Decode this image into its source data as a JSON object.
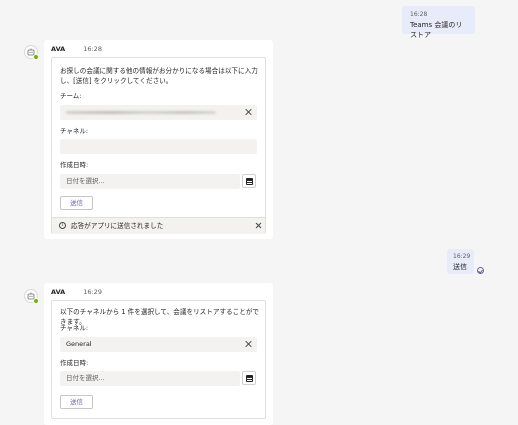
{
  "outgoing": [
    {
      "time": "16:28",
      "text": "Teams 会議のリストア"
    },
    {
      "time": "16:29",
      "text": "送信"
    }
  ],
  "bot_messages": [
    {
      "sender": "AVA",
      "time": "16:28",
      "card": {
        "instruction": "お探しの会議に関する他の情報がお分かりになる場合は以下に入力し、[送信] をクリックしてください。",
        "team_label": "チーム:",
        "channel_label": "チャネル:",
        "date_label": "作成日時:",
        "date_placeholder": "日付を選択...",
        "submit_label": "送信"
      },
      "notice": "応答がアプリに送信されました"
    },
    {
      "sender": "AVA",
      "time": "16:29",
      "card": {
        "instruction": "以下のチャネルから 1 件を選択して、会議をリストアすることができます。",
        "channel_label": "チャネル:",
        "channel_value": "General",
        "date_label": "作成日時:",
        "date_placeholder": "日付を選択...",
        "submit_label": "送信"
      }
    }
  ],
  "colors": {
    "accent": "#6264a7",
    "self_bubble": "#e8ebfa",
    "presence": "#6bb700"
  }
}
